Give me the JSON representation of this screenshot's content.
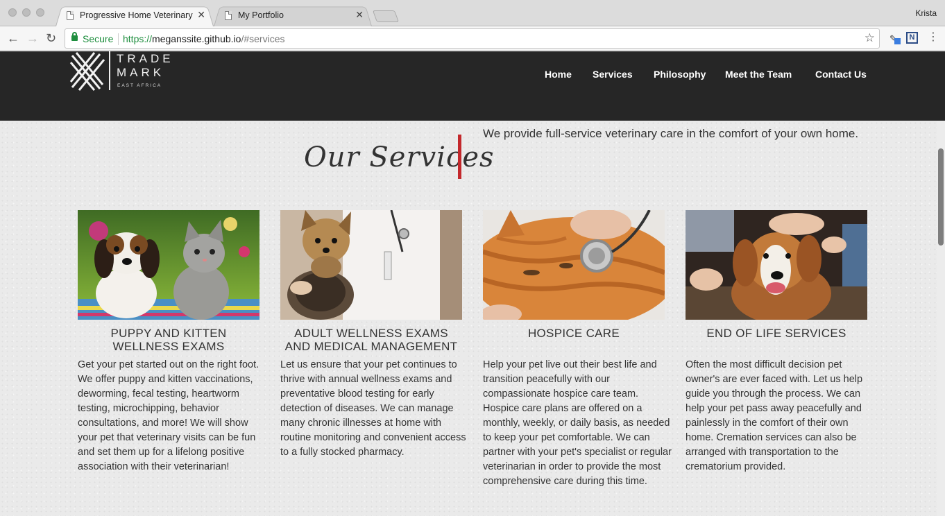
{
  "browser": {
    "tabs": [
      {
        "title": "Progressive Home Veterinary C",
        "active": true
      },
      {
        "title": "My Portfolio",
        "active": false
      }
    ],
    "profile_name": "Krista",
    "security_label": "Secure",
    "url": {
      "scheme": "https://",
      "host": "meganssite.github.io",
      "path": "/#services"
    },
    "icons": {
      "back": "back-arrow-icon",
      "forward": "forward-arrow-icon",
      "reload": "reload-icon",
      "bookmark": "star-icon",
      "menu": "more-vert-icon"
    },
    "ext_label": "N"
  },
  "site": {
    "logo": {
      "line1": "TRADE",
      "line2": "MARK",
      "line3": "EAST AFRICA"
    },
    "nav": [
      "Home",
      "Services",
      "Philosophy",
      "Meet the Team",
      "Contact Us"
    ],
    "header_bg": "#262626"
  },
  "services": {
    "heading": "Our Services",
    "tagline": "We provide full-service veterinary care in the comfort of your own home.",
    "accent": "#c3282c",
    "cards": [
      {
        "title": "PUPPY AND KITTEN WELLNESS EXAMS",
        "image": "puppy-and-kitten-photo",
        "text": "Get your pet started out on the right foot. We offer puppy and kitten vaccinations, deworming, fecal testing, heartworm testing, microchipping, behavior consultations, and more! We will show your pet that veterinary visits can be fun and set them up for a lifelong positive association with their veterinarian!"
      },
      {
        "title": "ADULT WELLNESS EXAMS AND MEDICAL MANAGEMENT",
        "image": "yorkie-with-vet-photo",
        "text": "Let us ensure that your pet continues to thrive with annual wellness exams and preventative blood testing for early detection of diseases. We can manage many chronic illnesses at home with routine monitoring and convenient access to a fully stocked pharmacy."
      },
      {
        "title": "HOSPICE CARE",
        "image": "cat-with-stethoscope-photo",
        "text": "Help your pet live out their best life and transition peacefully with our compassionate hospice care team. Hospice care plans are offered on a monthly, weekly, or daily basis, as needed to keep your pet comfortable. We can partner with your pet's specialist or regular veterinarian in order to provide the most comprehensive care during this time."
      },
      {
        "title": "END OF LIFE SERVICES",
        "image": "dog-being-petted-photo",
        "text": "Often the most difficult decision pet owner's are ever faced with. Let us help guide you through the process. We can help your pet pass away peacefully and painlessly in the comfort of their own home. Cremation services can also be arranged with transportation to the crematorium provided."
      }
    ]
  }
}
